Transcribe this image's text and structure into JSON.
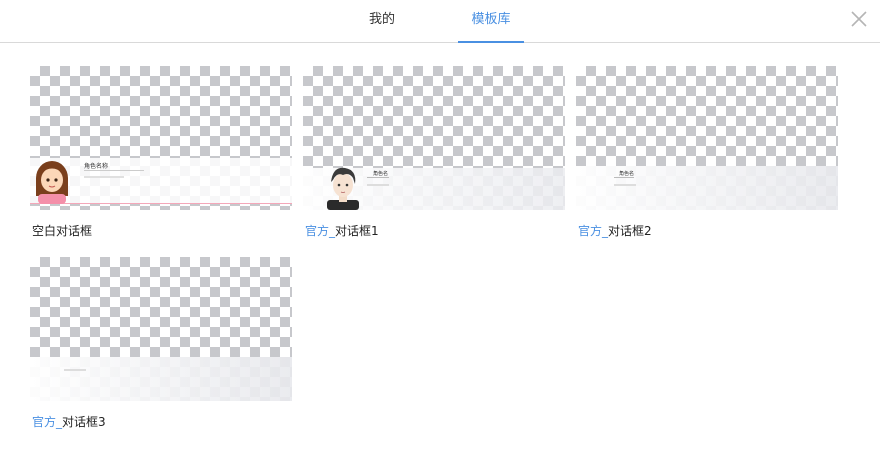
{
  "header": {
    "tabs": [
      {
        "label": "我的",
        "active": false
      },
      {
        "label": "模板库",
        "active": true
      }
    ],
    "close_icon": "close-icon"
  },
  "templates": [
    {
      "prefix": "",
      "name": "空白对话框",
      "preview_name": "角色名称"
    },
    {
      "prefix": "官方_",
      "name": "对话框1",
      "preview_name": "角色名"
    },
    {
      "prefix": "官方_",
      "name": "对话框2",
      "preview_name": "角色名"
    },
    {
      "prefix": "官方_",
      "name": "对话框3",
      "preview_name": ""
    }
  ],
  "colors": {
    "accent": "#4a90e2",
    "checker": "#c7c8cc",
    "divider": "#d9d9d9",
    "pink_line": "#f4a7b9"
  }
}
